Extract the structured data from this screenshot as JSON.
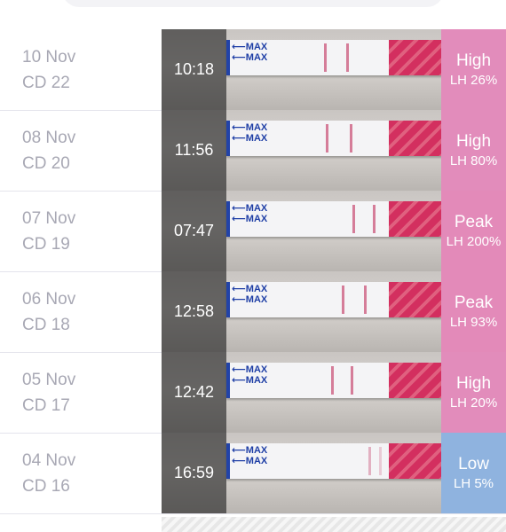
{
  "colors": {
    "high": "#e28cbb",
    "peak": "#e38ab9",
    "low": "#8fb3df",
    "date_text": "#a8a8b4"
  },
  "rows": [
    {
      "date": "10 Nov",
      "cycle_day": "CD 22",
      "time": "10:18",
      "level": "High",
      "lh": "LH 26%",
      "status": "high"
    },
    {
      "date": "08 Nov",
      "cycle_day": "CD 20",
      "time": "11:56",
      "level": "High",
      "lh": "LH 80%",
      "status": "high"
    },
    {
      "date": "07 Nov",
      "cycle_day": "CD 19",
      "time": "07:47",
      "level": "Peak",
      "lh": "LH 200%",
      "status": "peak"
    },
    {
      "date": "06 Nov",
      "cycle_day": "CD 18",
      "time": "12:58",
      "level": "Peak",
      "lh": "LH 93%",
      "status": "peak"
    },
    {
      "date": "05 Nov",
      "cycle_day": "CD 17",
      "time": "12:42",
      "level": "High",
      "lh": "LH 20%",
      "status": "high"
    },
    {
      "date": "04 Nov",
      "cycle_day": "CD 16",
      "time": "16:59",
      "level": "Low",
      "lh": "LH 5%",
      "status": "low"
    }
  ],
  "strip_text": "MAX"
}
